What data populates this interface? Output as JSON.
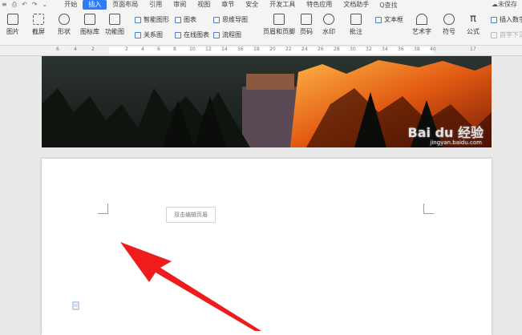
{
  "menubar": {
    "tabs": [
      {
        "label": "开始"
      },
      {
        "label": "插入",
        "active": true
      },
      {
        "label": "页面布局"
      },
      {
        "label": "引用"
      },
      {
        "label": "审阅"
      },
      {
        "label": "视图"
      },
      {
        "label": "章节"
      },
      {
        "label": "安全"
      },
      {
        "label": "开发工具"
      },
      {
        "label": "特色应用"
      },
      {
        "label": "文档助手"
      }
    ],
    "search_label": "Q查找",
    "unsaved_label": "未保存"
  },
  "ribbon": {
    "picture": "图片",
    "screenshot": "截屏",
    "shape": "形状",
    "icon_lib": "图标库",
    "func_chart": "功能图",
    "smart_graphic": "智能图形",
    "chart": "图表",
    "mindmap": "思维导图",
    "relation_map": "关系图",
    "online_chart": "在线图表",
    "flowchart": "流程图",
    "header_footer": "页眉和页脚",
    "page_number": "页码",
    "watermark": "水印",
    "comment": "批注",
    "textbox": "文本框",
    "wordart": "艺术字",
    "symbol": "符号",
    "formula": "公式",
    "insert_number": "插入数字",
    "first_letter": "首字下沉"
  },
  "ruler_numbers": [
    "6",
    "4",
    "2",
    "2",
    "4",
    "6",
    "8",
    "10",
    "12",
    "14",
    "16",
    "18",
    "20",
    "22",
    "24",
    "26",
    "28",
    "30",
    "32",
    "34",
    "36",
    "38",
    "40",
    "17"
  ],
  "page2": {
    "header_hint": "双击编辑页眉"
  },
  "watermark": {
    "main": "Bai du 经验",
    "sub": "jingyan.baidu.com"
  },
  "colors": {
    "accent": "#2f7cf6",
    "arrow": "#ee1c1c"
  }
}
